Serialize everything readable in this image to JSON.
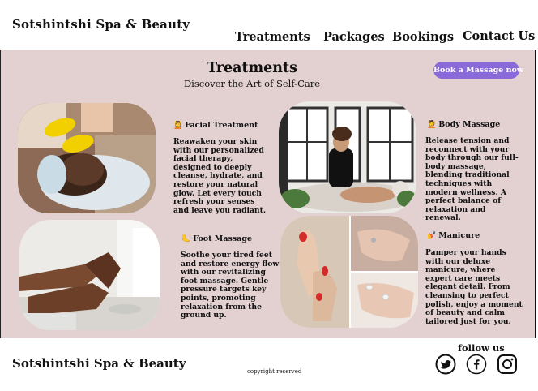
{
  "header": {
    "brand": "Sotshintshi Spa & Beauty",
    "nav": [
      "Treatments",
      "Packages",
      "Bookings",
      "Contact Us"
    ]
  },
  "main": {
    "title": "Treatments",
    "subtitle": "Discover the Art of Self-Care",
    "cta_label": "Book a Massage now",
    "services": [
      {
        "emoji": "💆",
        "title": "Facial Treatment",
        "description": "Reawaken your skin with our personalized facial therapy, designed to deeply cleanse, hydrate, and restore your natural glow. Let every touch refresh your senses and leave you radiant."
      },
      {
        "emoji": "💆",
        "title": "Body Massage",
        "description": "Release tension and reconnect with your body through our full-body massage, blending traditional techniques with modern wellness. A perfect balance of relaxation and renewal."
      },
      {
        "emoji": "🦶",
        "title": "Foot Massage",
        "description": "Soothe your tired feet and restore energy flow with our revitalizing foot massage. Gentle pressure targets key points, promoting relaxation from the ground up."
      },
      {
        "emoji": "💅",
        "title": "Manicure",
        "description": "Pamper your hands with our deluxe manicure, where expert care meets elegant detail. From cleansing to perfect polish, enjoy a moment of beauty and calm tailored just for you."
      }
    ]
  },
  "footer": {
    "brand": "Sotshintshi Spa & Beauty",
    "copyright": "copyright reserved",
    "follow_label": "follow us",
    "social": [
      "twitter-icon",
      "facebook-icon",
      "instagram-icon"
    ]
  },
  "colors": {
    "background": "#e3d1d2",
    "accent": "#8a69d8",
    "text": "#111111"
  }
}
